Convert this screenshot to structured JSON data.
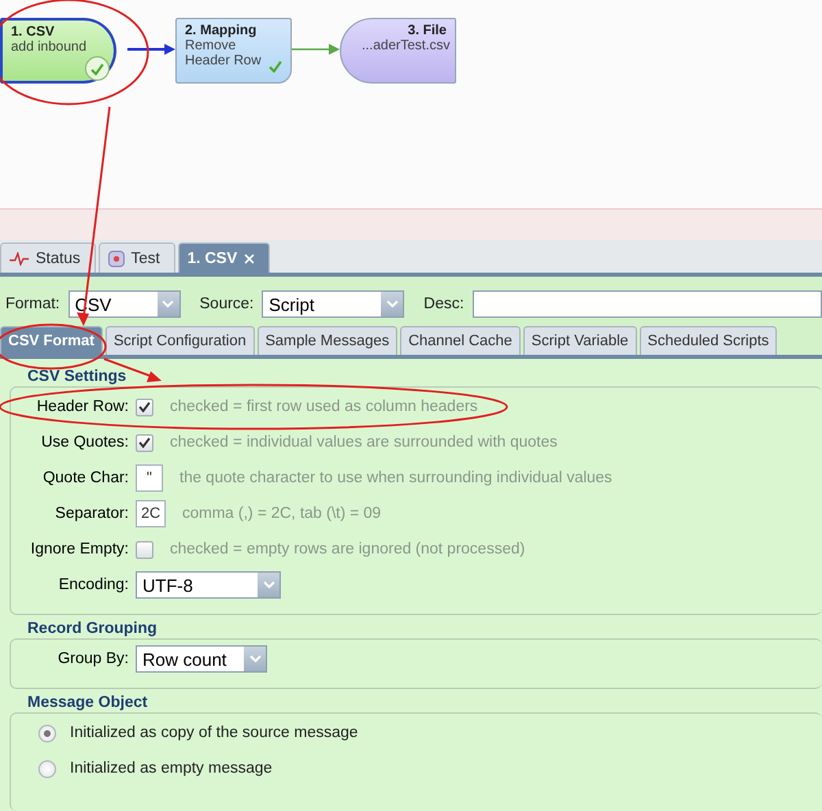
{
  "diagram": {
    "nodes": [
      {
        "kind": "source",
        "title": "1. CSV",
        "subtitle": "add inbound",
        "selected": true,
        "ok": true
      },
      {
        "kind": "step",
        "title": "2. Mapping",
        "subtitle": "Remove Header Row",
        "selected": false,
        "ok": true
      },
      {
        "kind": "destination",
        "title": "3. File",
        "subtitle": "...aderTest.csv",
        "selected": false,
        "ok": false
      }
    ]
  },
  "tabs": [
    {
      "kind": "monitor",
      "label": "Status",
      "selected": false,
      "closable": false
    },
    {
      "kind": "test",
      "label": "Test",
      "selected": false,
      "closable": false
    },
    {
      "kind": "channel",
      "label": "1. CSV",
      "selected": true,
      "closable": true
    }
  ],
  "format_row": {
    "format_label": "Format:",
    "format": "CSV",
    "source_label": "Source:",
    "source": "Script",
    "desc_label": "Desc:"
  },
  "sub_tabs": [
    {
      "label": "CSV Format",
      "selected": true
    },
    {
      "label": "Script Configuration",
      "selected": false
    },
    {
      "label": "Sample Messages",
      "selected": false
    },
    {
      "label": "Channel Cache",
      "selected": false
    },
    {
      "label": "Script Variable",
      "selected": false
    },
    {
      "label": "Scheduled Scripts",
      "selected": false
    }
  ],
  "csv_settings": {
    "title": "CSV Settings",
    "rows": [
      {
        "kind": "checkbox",
        "label": "Header Row:",
        "checked": true,
        "hint": "checked = first row used as column headers"
      },
      {
        "kind": "checkbox",
        "label": "Use Quotes:",
        "checked": true,
        "hint": "checked = individual values are surrounded with quotes"
      },
      {
        "kind": "text",
        "label": "Quote Char:",
        "value": "\"",
        "hint": "the quote character to use when surrounding individual values"
      },
      {
        "kind": "text",
        "label": "Separator:",
        "value": "2C",
        "hint": "comma (,) = 2C, tab (\\t) = 09"
      },
      {
        "kind": "checkbox",
        "label": "Ignore Empty:",
        "checked": false,
        "hint": "checked = empty rows are ignored (not processed)"
      },
      {
        "kind": "select",
        "label": "Encoding:",
        "value": "UTF-8"
      }
    ]
  },
  "record_grouping": {
    "title": "Record Grouping",
    "label": "Group By:",
    "value": "Row count"
  },
  "message_object": {
    "title": "Message Object",
    "options": [
      {
        "label": "Initialized as copy of the source message",
        "selected": true
      },
      {
        "label": "Initialized as empty message",
        "selected": false
      }
    ]
  }
}
